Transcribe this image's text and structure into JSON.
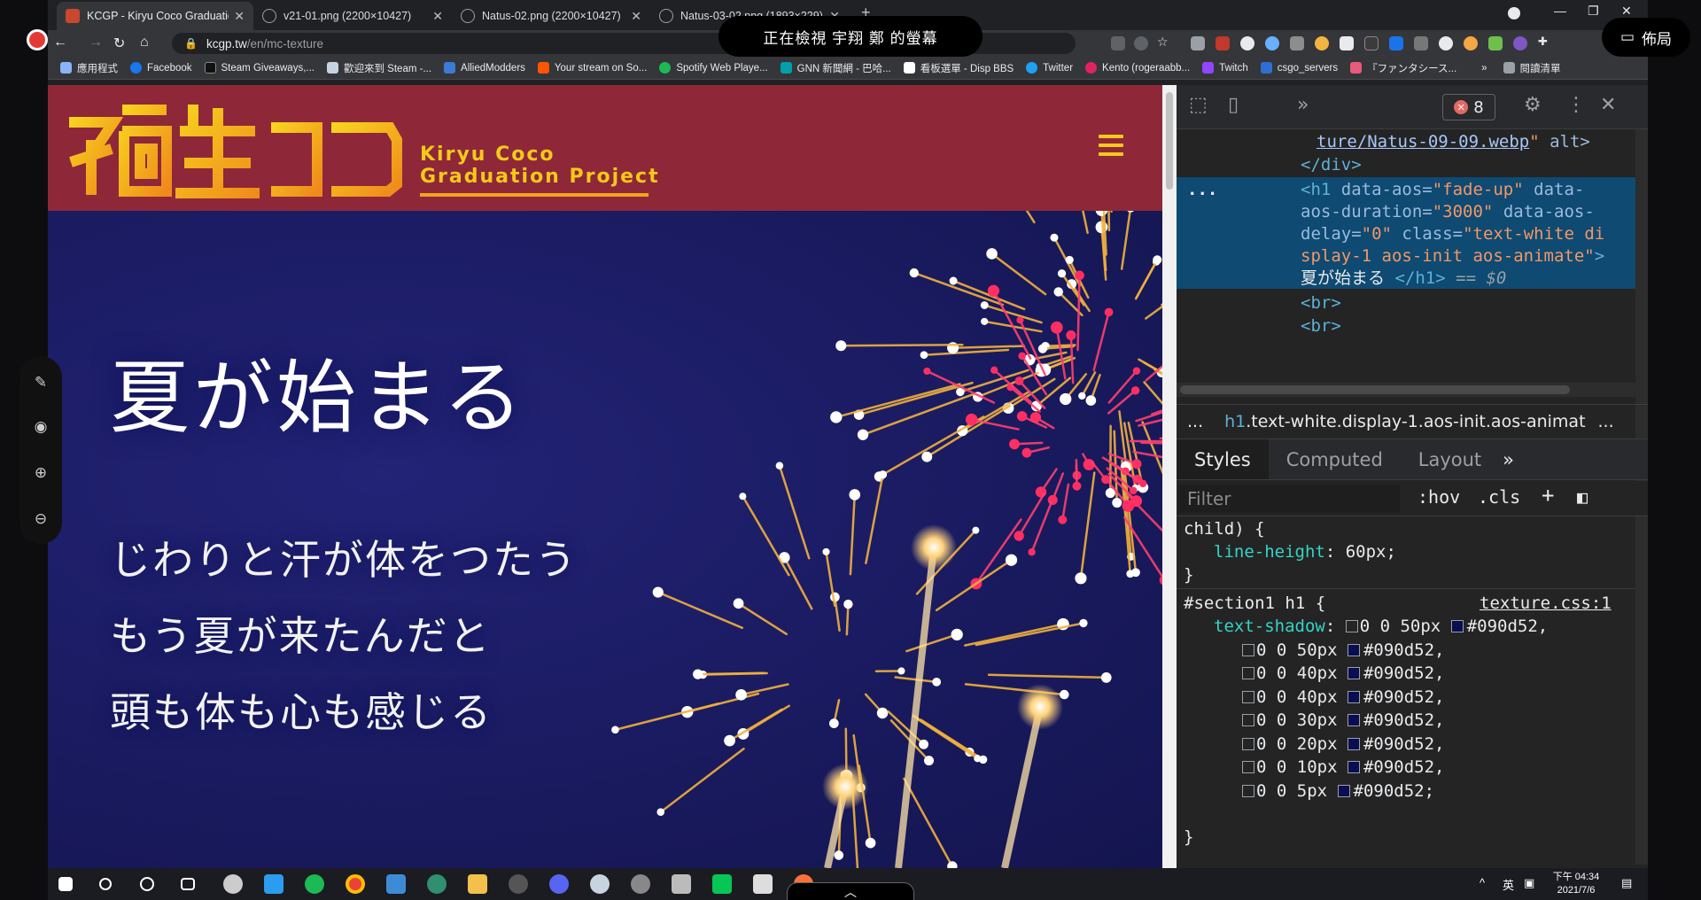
{
  "browser": {
    "tabs": [
      {
        "title": "KCGP - Kiryu Coco Graduation",
        "active": true,
        "icon": "kcgp-favicon"
      },
      {
        "title": "v21-01.png (2200×10427)",
        "active": false,
        "icon": "globe-icon"
      },
      {
        "title": "Natus-02.png (2200×10427)",
        "active": false,
        "icon": "globe-icon"
      },
      {
        "title": "Natus-03-02.png (1893×229)",
        "active": false,
        "icon": "globe-icon"
      }
    ],
    "new_tab": "+",
    "url_host": "kcgp.tw",
    "url_path": "/en/mc-texture",
    "bookmarks": [
      {
        "label": "應用程式",
        "color": "#8ab4f8"
      },
      {
        "label": "Facebook",
        "color": "#1877f2"
      },
      {
        "label": "Steam Giveaways,...",
        "color": "#111111"
      },
      {
        "label": "歡迎來到 Steam -...",
        "color": "#1b2838"
      },
      {
        "label": "AlliedModders",
        "color": "#3a7bd5"
      },
      {
        "label": "Your stream on So...",
        "color": "#ff5500"
      },
      {
        "label": "Spotify Web Playe...",
        "color": "#1db954"
      },
      {
        "label": "GNN 新聞網 - 巴哈...",
        "color": "#00a0a8"
      },
      {
        "label": "看板選單 - Disp BBS",
        "color": "#ffffff"
      },
      {
        "label": "Twitter",
        "color": "#1da1f2"
      },
      {
        "label": "Kento (rogeraabb...",
        "color": "#e0245e"
      },
      {
        "label": "Twitch",
        "color": "#9146ff"
      },
      {
        "label": "csgo_servers",
        "color": "#2f6fd1"
      },
      {
        "label": "『ファンタシース...",
        "color": "#e85b7a"
      }
    ],
    "bookmarks_more": "»",
    "reading_list": "閱讀清單"
  },
  "overlay": {
    "share_banner": "正在檢視 宇翔 鄭 的螢幕",
    "layout_button": "佈局"
  },
  "page": {
    "logo_line1": "Kiryu Coco",
    "logo_line2": "Graduation Project",
    "hero_title": "夏が始まる",
    "hero_lines": [
      "じわりと汗が体をつたう",
      "もう夏が来たんだと",
      "頭も体も心も感じる"
    ],
    "accent_color": "#f5c91a",
    "header_bg": "#8e2838",
    "hero_bg": "#1a1a5c"
  },
  "devtools": {
    "error_count": "8",
    "dom": {
      "line1": "ture/Natus-09-09.webp",
      "line1_attr": "alt>",
      "close_div": "</div>",
      "h1_tag": "<h1",
      "h1_attr1": "data-aos=",
      "h1_val1": "\"fade-up\"",
      "h1_attr2": "data-",
      "h1_attr2b": "aos-duration=",
      "h1_val2": "\"3000\"",
      "h1_attr3": "data-aos-",
      "h1_attr3b": "delay=",
      "h1_val3": "\"0\"",
      "h1_attr4": "class=",
      "h1_val4a": "\"text-white di",
      "h1_val4b": "splay-1 aos-init aos-animate\"",
      "h1_text": "夏が始まる",
      "h1_close": "</h1>",
      "h1_eq": "== $0",
      "br": "<br>",
      "ellipsis": "..."
    },
    "breadcrumb_prefix": "...",
    "breadcrumb_tag": "h1",
    "breadcrumb_rest": ".text-white.display-1.aos-init.aos-animat",
    "breadcrumb_suffix": "...",
    "subtabs": [
      "Styles",
      "Computed",
      "Layout"
    ],
    "subtabs_more": "»",
    "filter_placeholder": "Filter",
    "hov": ":hov",
    "cls": ".cls",
    "plus": "+",
    "styles": {
      "child_sel": "child) {",
      "lh_prop": "line-height",
      "lh_val": "60px;",
      "close": "}",
      "selector": "#section1 h1 {",
      "source": "texture.css:1",
      "ts_prop": "text-shadow",
      "shadows": [
        "0 0 50px",
        "0 0 50px",
        "0 0 40px",
        "0 0 40px",
        "0 0 30px",
        "0 0 20px",
        "0 0 10px",
        "0 0 5px"
      ],
      "shadow_color": "#090d52"
    }
  },
  "taskbar": {
    "time": "下午 04:34",
    "date": "2021/7/6",
    "ime": "英"
  },
  "bottom_tab": "︿"
}
